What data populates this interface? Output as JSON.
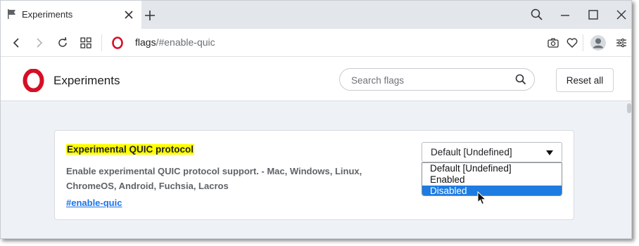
{
  "tab": {
    "title": "Experiments",
    "icon": "flag-icon"
  },
  "toolbar": {
    "url_host": "flags",
    "url_path": "/#enable-quic"
  },
  "header": {
    "title": "Experiments",
    "search_placeholder": "Search flags",
    "reset_label": "Reset all"
  },
  "flag": {
    "title": "Experimental QUIC protocol",
    "description": "Enable experimental QUIC protocol support. - Mac, Windows, Linux, ChromeOS, Android, Fuchsia, Lacros",
    "link": "#enable-quic",
    "select_value": "Default [Undefined]",
    "options": [
      "Default [Undefined]",
      "Enabled",
      "Disabled"
    ],
    "highlighted_option": "Disabled"
  },
  "colors": {
    "accent": "#1e7be0",
    "highlight": "#ffff00",
    "brand": "#d50f25"
  }
}
